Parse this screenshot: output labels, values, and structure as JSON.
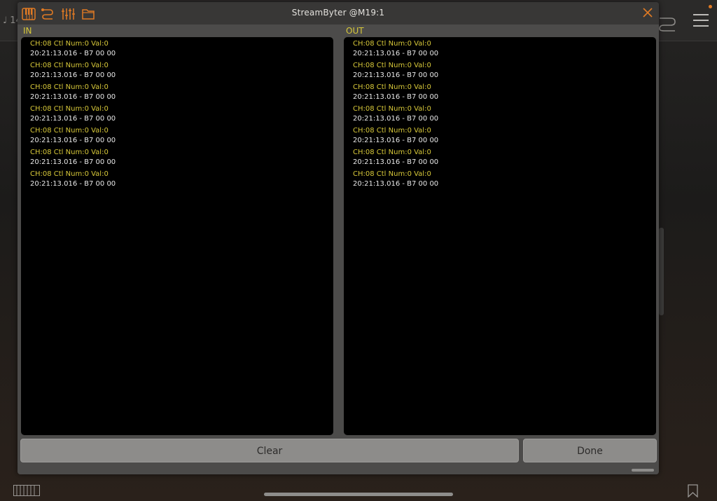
{
  "background": {
    "note_text": "♩ 14"
  },
  "window": {
    "title": "StreamByter @M19:1"
  },
  "panels": {
    "in_label": "IN",
    "out_label": "OUT",
    "in_log": [
      {
        "event": "CH:08 Ctl Num:0 Val:0",
        "hex": "20:21:13.016 - B7 00 00"
      },
      {
        "event": "CH:08 Ctl Num:0 Val:0",
        "hex": "20:21:13.016 - B7 00 00"
      },
      {
        "event": "CH:08 Ctl Num:0 Val:0",
        "hex": "20:21:13.016 - B7 00 00"
      },
      {
        "event": "CH:08 Ctl Num:0 Val:0",
        "hex": "20:21:13.016 - B7 00 00"
      },
      {
        "event": "CH:08 Ctl Num:0 Val:0",
        "hex": "20:21:13.016 - B7 00 00"
      },
      {
        "event": "CH:08 Ctl Num:0 Val:0",
        "hex": "20:21:13.016 - B7 00 00"
      },
      {
        "event": "CH:08 Ctl Num:0 Val:0",
        "hex": "20:21:13.016 - B7 00 00"
      }
    ],
    "out_log": [
      {
        "event": "CH:08 Ctl Num:0 Val:0",
        "hex": "20:21:13.016 - B7 00 00"
      },
      {
        "event": "CH:08 Ctl Num:0 Val:0",
        "hex": "20:21:13.016 - B7 00 00"
      },
      {
        "event": "CH:08 Ctl Num:0 Val:0",
        "hex": "20:21:13.016 - B7 00 00"
      },
      {
        "event": "CH:08 Ctl Num:0 Val:0",
        "hex": "20:21:13.016 - B7 00 00"
      },
      {
        "event": "CH:08 Ctl Num:0 Val:0",
        "hex": "20:21:13.016 - B7 00 00"
      },
      {
        "event": "CH:08 Ctl Num:0 Val:0",
        "hex": "20:21:13.016 - B7 00 00"
      },
      {
        "event": "CH:08 Ctl Num:0 Val:0",
        "hex": "20:21:13.016 - B7 00 00"
      }
    ]
  },
  "buttons": {
    "clear_label": "Clear",
    "done_label": "Done"
  },
  "toolbar_icons": [
    "piano-keys-icon",
    "routing-icon",
    "mixer-sliders-icon",
    "folder-icon"
  ],
  "colors": {
    "accent": "#e07a24",
    "event_text": "#d7c839",
    "hex_text": "#e8e8e8",
    "panel_bg": "#000000"
  }
}
